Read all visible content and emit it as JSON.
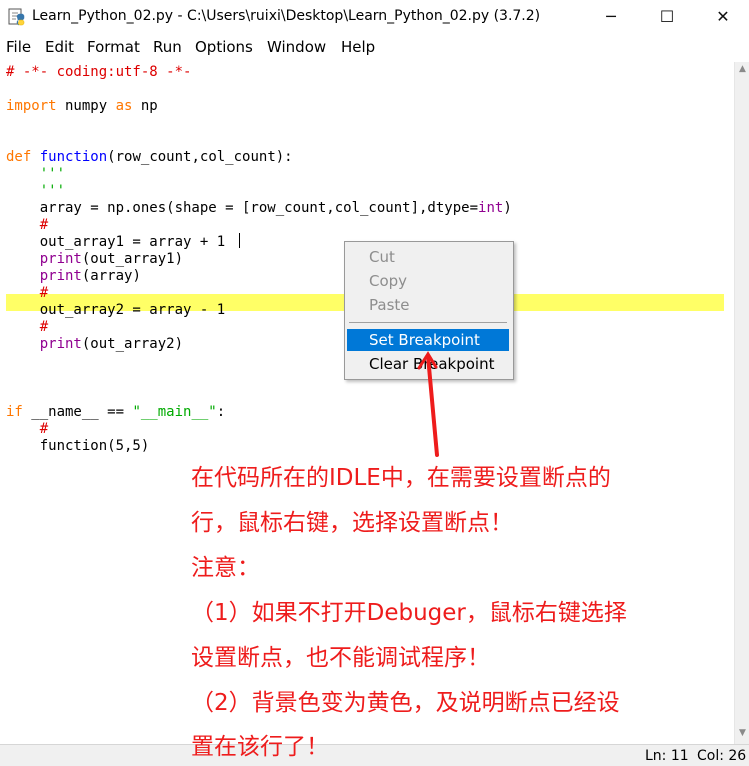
{
  "window": {
    "title": "Learn_Python_02.py - C:\\Users\\ruixi\\Desktop\\Learn_Python_02.py (3.7.2)",
    "controls": {
      "minimize": "─",
      "maximize": "☐",
      "close": "✕"
    }
  },
  "menubar": [
    "File",
    "Edit",
    "Format",
    "Run",
    "Options",
    "Window",
    "Help"
  ],
  "code": {
    "coding": "# -*- coding:utf-8 -*-",
    "import_kw": "import",
    "import_mod": " numpy ",
    "as_kw": "as",
    "import_alias": " np",
    "def_kw": "def",
    "func_name": "function",
    "def_args": "(row_count,col_count):",
    "docstring_1": "    '''",
    "docstring_2": "    '''",
    "array_pre": "    array = np.ones(shape = [row_count,col_count],dtype=",
    "int_bi": "int",
    "array_post": ")",
    "hash_1": "    #",
    "out1_line": "    out_array1 = array + 1",
    "print_1_indent": "    ",
    "print_1_bi": "print",
    "print_1_args": "(out_array1)",
    "print_2_indent": "    ",
    "print_2_bi": "print",
    "print_2_args": "(array)",
    "hash_2": "    #",
    "out2_line": "    out_array2 = array - 1",
    "hash_3": "    #",
    "print_3_indent": "    ",
    "print_3_bi": "print",
    "print_3_args": "(out_array2)",
    "if_kw": "if",
    "if_mid": " __name__ == ",
    "if_str": "\"__main__\"",
    "if_end": ":",
    "hash_4": "    #",
    "call_line": "    function(5,5)"
  },
  "context_menu": {
    "cut": "Cut",
    "copy": "Copy",
    "paste": "Paste",
    "set_breakpoint": "Set Breakpoint",
    "clear_breakpoint": "Clear Breakpoint"
  },
  "annotation": {
    "line_1": "在代码所在的IDLE中，在需要设置断点的",
    "line_2": "行，鼠标右键，选择设置断点！",
    "line_3": "注意：",
    "line_4": "（1）如果不打开Debuger，鼠标右键选择",
    "line_5": "设置断点，也不能调试程序！",
    "line_6": "（2）背景色变为黄色，及说明断点已经设",
    "line_7": "置在该行了！"
  },
  "status": {
    "line": "Ln: 11",
    "column": "Col: 26"
  },
  "colors": {
    "breakpoint_highlight": "#ffff66",
    "keyword": "#ff7700",
    "definition": "#0000ff",
    "comment": "#dd0000",
    "string": "#00aa00",
    "builtin": "#900090",
    "menu_selection": "#0078d7",
    "annotation": "#ee1c1c"
  }
}
